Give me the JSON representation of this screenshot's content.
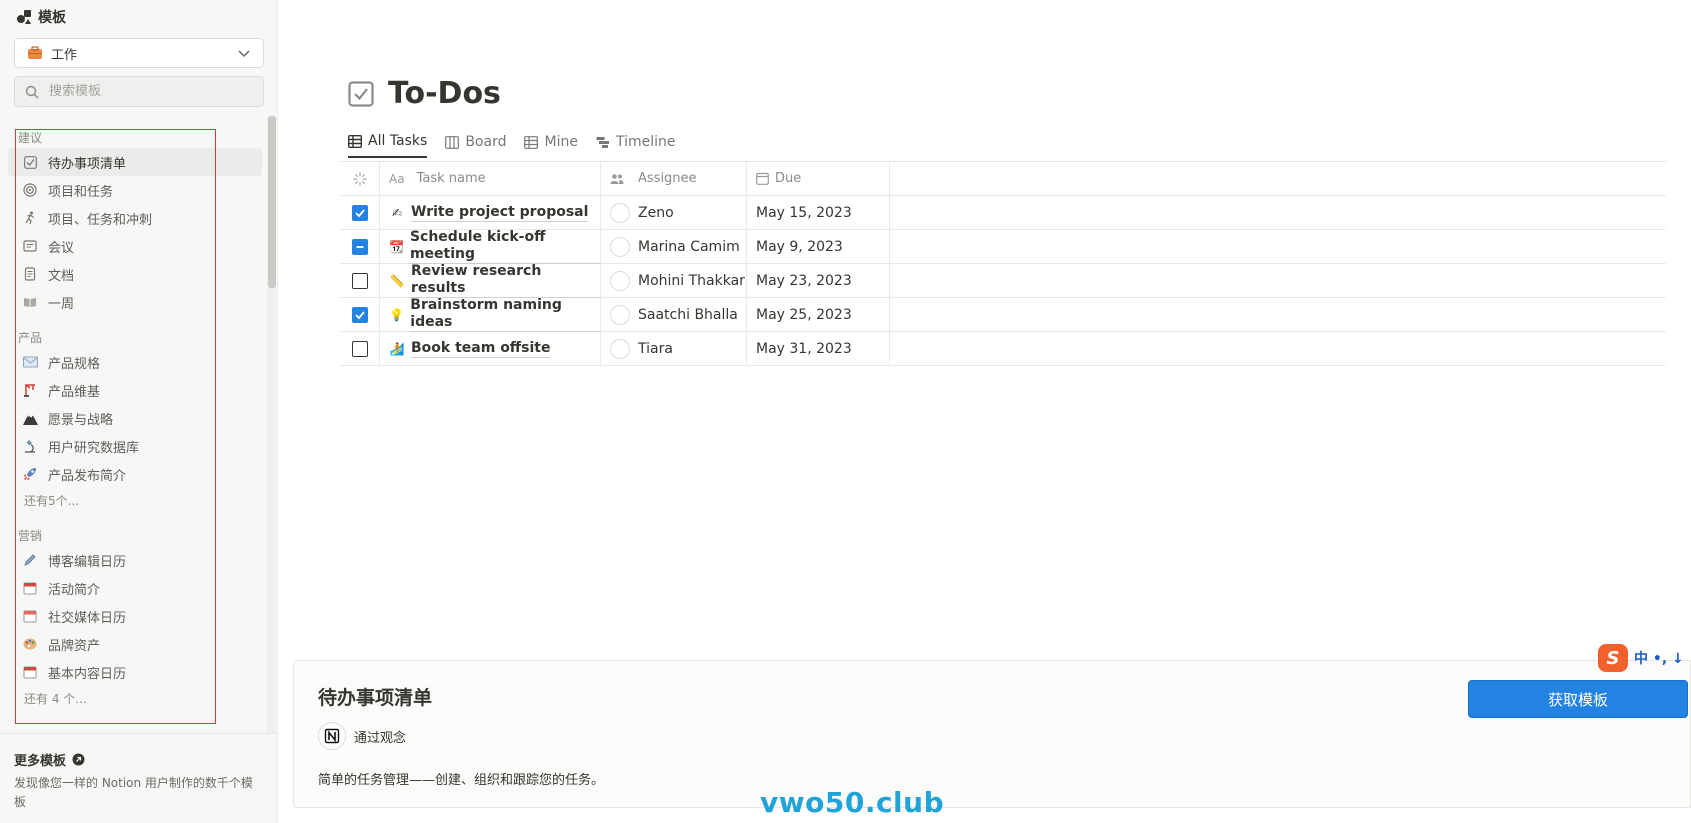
{
  "sidebar": {
    "title": "模板",
    "category": {
      "label": "工作"
    },
    "search": {
      "placeholder": "搜索模板",
      "value": ""
    },
    "sections": [
      {
        "title": "建议",
        "items": [
          {
            "label": "待办事项清单",
            "icon": "checkbox-icon",
            "active": true
          },
          {
            "label": "项目和任务",
            "icon": "target-icon"
          },
          {
            "label": "项目、任务和冲刺",
            "icon": "runner-icon"
          },
          {
            "label": "会议",
            "icon": "notes-icon"
          },
          {
            "label": "文档",
            "icon": "document-icon"
          },
          {
            "label": "一周",
            "icon": "book-icon"
          }
        ]
      },
      {
        "title": "产品",
        "items": [
          {
            "label": "产品规格",
            "icon": "envelope-icon"
          },
          {
            "label": "产品维基",
            "icon": "crane-icon"
          },
          {
            "label": "愿景与战略",
            "icon": "mountain-icon"
          },
          {
            "label": "用户研究数据库",
            "icon": "microscope-icon"
          },
          {
            "label": "产品发布简介",
            "icon": "rocket-icon"
          }
        ],
        "more": "还有5个..."
      },
      {
        "title": "营销",
        "items": [
          {
            "label": "博客编辑日历",
            "icon": "pen-icon"
          },
          {
            "label": "活动简介",
            "icon": "calendar-icon"
          },
          {
            "label": "社交媒体日历",
            "icon": "calendar-icon"
          },
          {
            "label": "品牌资产",
            "icon": "palette-icon"
          },
          {
            "label": "基本内容日历",
            "icon": "calendar-icon"
          }
        ],
        "more": "还有 4 个..."
      }
    ],
    "footer": {
      "title": "更多模板",
      "desc": "发现像您一样的 Notion 用户制作的数千个模板"
    }
  },
  "page": {
    "title": "To-Dos",
    "tabs": [
      {
        "label": "All Tasks",
        "icon": "table-icon",
        "active": true
      },
      {
        "label": "Board",
        "icon": "board-icon"
      },
      {
        "label": "Mine",
        "icon": "table-icon"
      },
      {
        "label": "Timeline",
        "icon": "timeline-icon"
      }
    ],
    "columns": {
      "task": "Task name",
      "assignee": "Assignee",
      "due": "Due"
    },
    "rows": [
      {
        "state": "checked",
        "emoji": "✍",
        "task": "Write project proposal",
        "assignee": "Zeno",
        "due": "May 15, 2023"
      },
      {
        "state": "partial",
        "emoji": "📆",
        "task": "Schedule kick-off meeting",
        "assignee": "Marina Camim",
        "due": "May 9, 2023"
      },
      {
        "state": "unchecked",
        "emoji": "📏",
        "task": "Review research results",
        "assignee": "Mohini Thakkar",
        "due": "May 23, 2023"
      },
      {
        "state": "checked",
        "emoji": "💡",
        "task": "Brainstorm naming ideas",
        "assignee": "Saatchi Bhalla",
        "due": "May 25, 2023"
      },
      {
        "state": "unchecked",
        "emoji": "🏄",
        "task": "Book team offsite",
        "assignee": "Tiara",
        "due": "May 31, 2023"
      }
    ]
  },
  "detail": {
    "title": "待办事项清单",
    "by": "通过观念",
    "desc": "简单的任务管理——创建、组织和跟踪您的任务。",
    "button": "获取模板"
  },
  "overlay": {
    "watermark": "vwo50.club",
    "ime": {
      "logo": "S",
      "text": "中 •, ↓"
    }
  },
  "colors": {
    "accent": "#2383e2",
    "selection": "#e0313d",
    "watermark": "#1fa3d8",
    "ime": "#f2602e"
  }
}
